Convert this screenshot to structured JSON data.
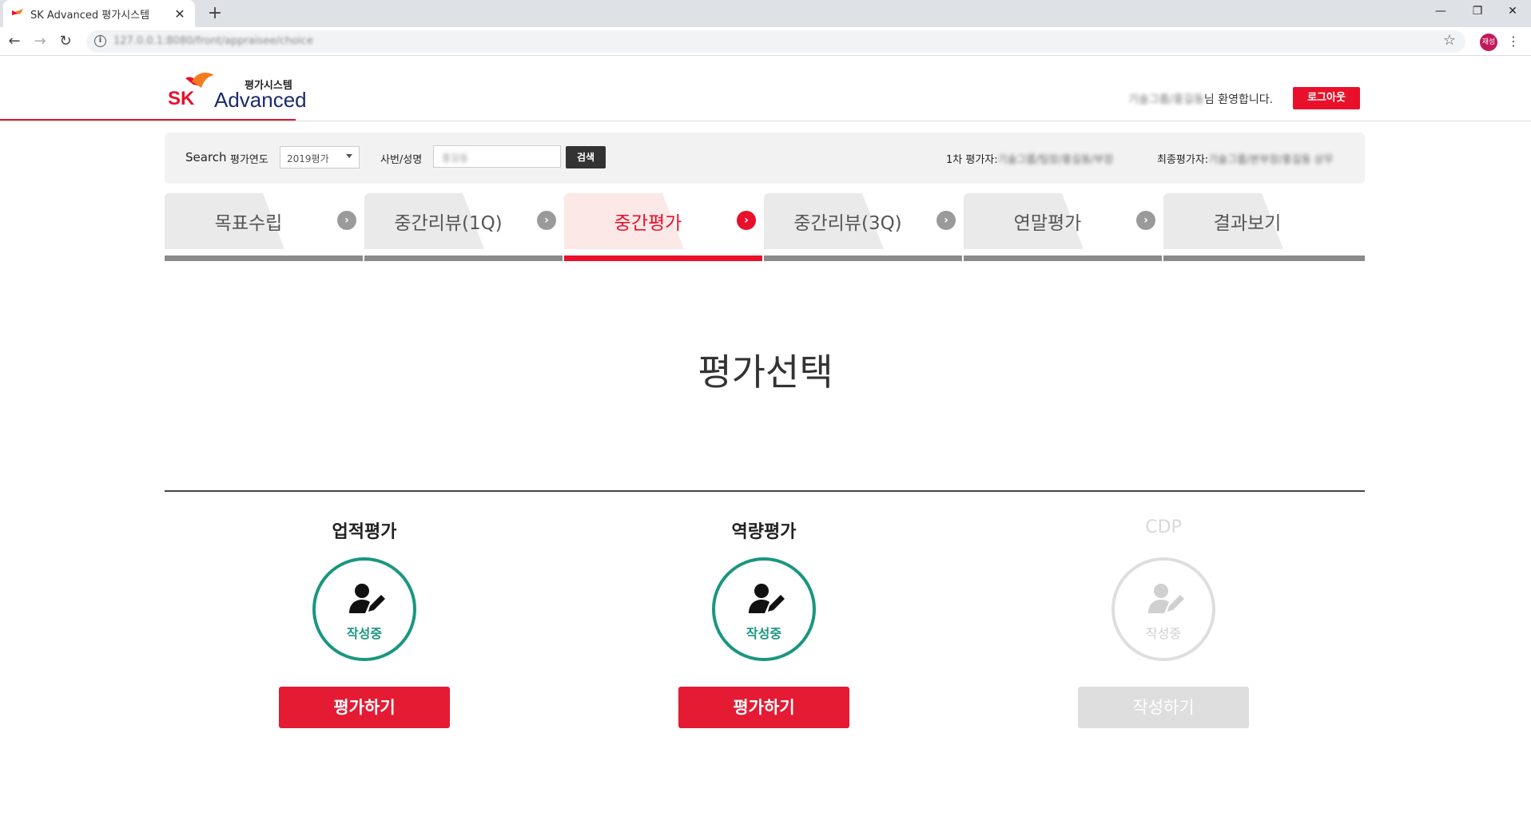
{
  "browser": {
    "tab_title": "SK Advanced 평가시스템",
    "url": "127.0.0.1:8080/front/appraisee/choice",
    "profile_initial": "재성"
  },
  "header": {
    "logo_sub": "평가시스템",
    "logo_sk": "SK",
    "logo_advanced": "Advanced",
    "welcome_name": "기술그룹/홍길동",
    "welcome_suffix": "님 환영합니다.",
    "logout_label": "로그아웃"
  },
  "search": {
    "search_label": "Search",
    "year_label": "평가연도",
    "year_value": "2019평가",
    "emp_label": "사번/성명",
    "emp_value": "홍길동",
    "button_label": "검색",
    "first_evaluator_label": "1차 평가자:",
    "first_evaluator_value": "기술그룹/팀장/홍길동/부장",
    "final_evaluator_label": "최종평가자:",
    "final_evaluator_value": "기술그룹/본부장/홍길동 상무"
  },
  "steps": [
    {
      "label": "목표수립"
    },
    {
      "label": "중간리뷰(1Q)"
    },
    {
      "label": "중간평가"
    },
    {
      "label": "중간리뷰(3Q)"
    },
    {
      "label": "연말평가"
    },
    {
      "label": "결과보기"
    }
  ],
  "active_step": 2,
  "main": {
    "title": "평가선택",
    "cards": [
      {
        "title": "업적평가",
        "status": "작성중",
        "button": "평가하기"
      },
      {
        "title": "역량평가",
        "status": "작성중",
        "button": "평가하기"
      },
      {
        "title": "CDP",
        "status": "작성중",
        "button": "작성하기"
      }
    ]
  },
  "colors": {
    "brand_red": "#e8102a",
    "teal": "#1a9680",
    "disabled_gray": "#dedede"
  }
}
